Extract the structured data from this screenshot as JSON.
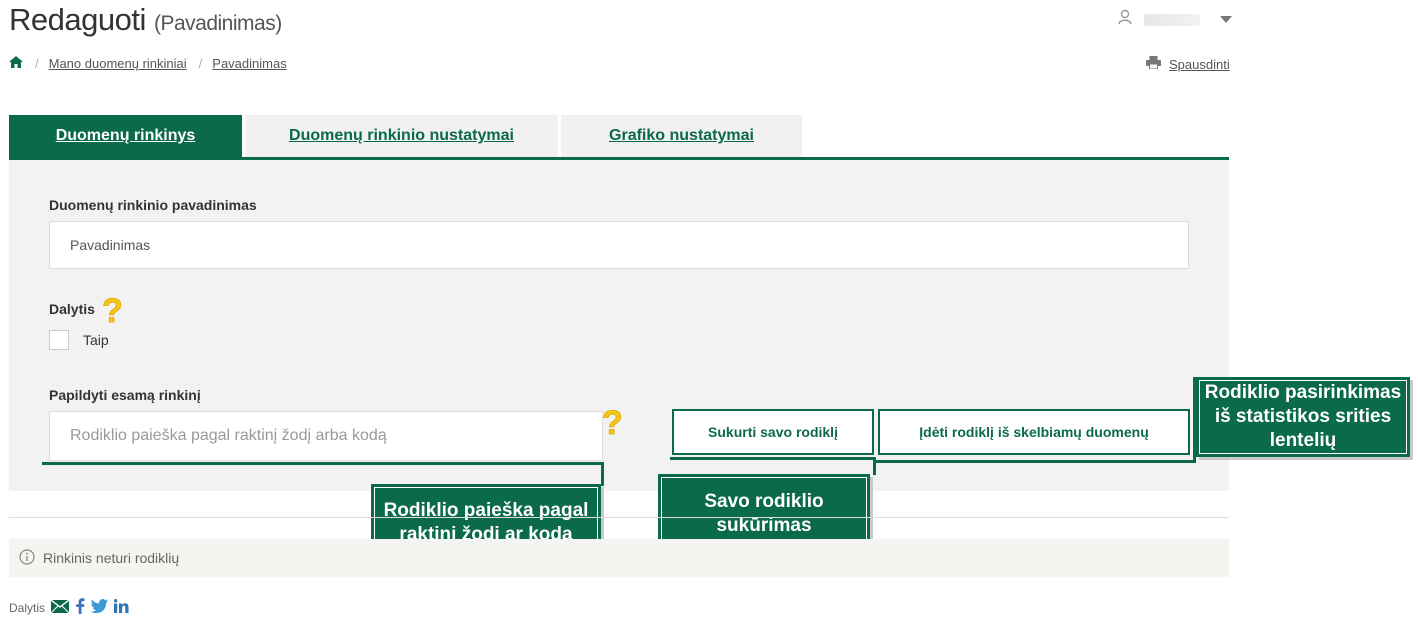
{
  "header": {
    "title": "Redaguoti",
    "subtitle": "(Pavadinimas)",
    "print_label": "Spausdinti"
  },
  "breadcrumb": {
    "items": [
      "Mano duomenų rinkiniai",
      "Pavadinimas"
    ]
  },
  "tabs": [
    {
      "label": "Duomenų rinkinys",
      "active": true
    },
    {
      "label": "Duomenų rinkinio nustatymai",
      "active": false
    },
    {
      "label": "Grafiko nustatymai",
      "active": false
    }
  ],
  "form": {
    "name_label": "Duomenų rinkinio pavadinimas",
    "name_value": "Pavadinimas",
    "share_label": "Dalytis",
    "share_option": "Taip",
    "append_label": "Papildyti esamą rinkinį",
    "search_placeholder": "Rodiklio paieška pagal raktinį žodį arba kodą",
    "create_button": "Sukurti savo rodiklį",
    "insert_button": "Įdėti rodiklį iš skelbiamų duomenų"
  },
  "callouts": {
    "search": "Rodiklio paieška pagal raktinį žodį ar kodą",
    "create": "Savo rodiklio sukūrimas",
    "select": "Rodiklio pasirinkimas iš statistikos srities lentelių"
  },
  "status": {
    "empty_message": "Rinkinis neturi rodiklių"
  },
  "footer": {
    "share_label": "Dalytis"
  },
  "colors": {
    "accent": "#0b6a4a",
    "help_icon": "#f5c518"
  }
}
